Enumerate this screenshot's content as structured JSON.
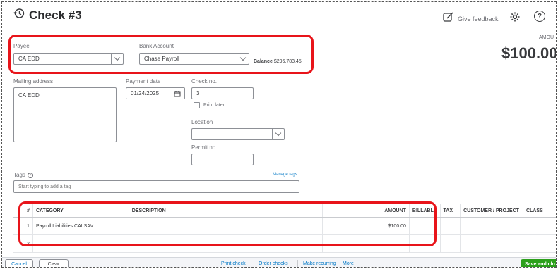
{
  "header": {
    "title": "Check #3",
    "feedback_label": "Give feedback",
    "amount_label": "AMOU",
    "amount_value": "$100.00"
  },
  "payee": {
    "label": "Payee",
    "value": "CA EDD"
  },
  "bank_account": {
    "label": "Bank Account",
    "value": "Chase Payroll",
    "balance_label": "Balance",
    "balance_value": "$296,783.45"
  },
  "mailing": {
    "label": "Mailing address",
    "value": "CA EDD"
  },
  "payment_date": {
    "label": "Payment date",
    "value": "01/24/2025"
  },
  "check_no": {
    "label": "Check no.",
    "value": "3",
    "print_later_label": "Print later"
  },
  "location": {
    "label": "Location",
    "value": ""
  },
  "permit": {
    "label": "Permit no.",
    "value": ""
  },
  "tags": {
    "label": "Tags",
    "manage_label": "Manage tags",
    "placeholder": "Start typing to add a tag"
  },
  "table": {
    "headers": [
      "#",
      "CATEGORY",
      "DESCRIPTION",
      "AMOUNT",
      "BILLABLE",
      "TAX",
      "CUSTOMER / PROJECT",
      "CLASS"
    ],
    "rows": [
      {
        "num": "1",
        "category": "Payroll Liabilities:CALSAV",
        "description": "",
        "amount": "$100.00"
      },
      {
        "num": "2",
        "category": "",
        "description": "",
        "amount": ""
      }
    ]
  },
  "footer": {
    "cancel": "Cancel",
    "clear": "Clear",
    "print_check": "Print check",
    "order_checks": "Order checks",
    "make_recurring": "Make recurring",
    "more": "More",
    "save_close": "Save and clo"
  },
  "colors": {
    "annotation_red": "#e8141a",
    "link_blue": "#0077c5",
    "save_green": "#2ca01c"
  }
}
